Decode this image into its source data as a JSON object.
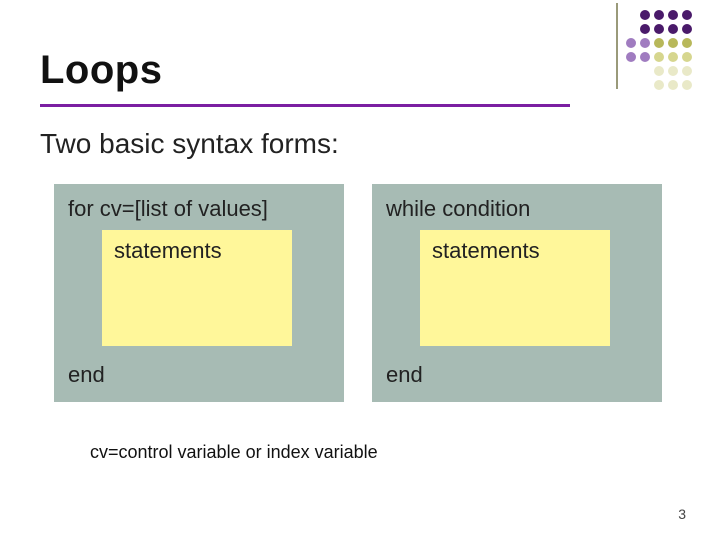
{
  "title": "Loops",
  "subtitle": "Two basic syntax forms:",
  "panels": [
    {
      "header": "for cv=[list of values]",
      "body": "statements",
      "end": "end"
    },
    {
      "header": "while condition",
      "body": "statements",
      "end": "end"
    }
  ],
  "footnote": "cv=control variable or index variable",
  "page_number": "3"
}
